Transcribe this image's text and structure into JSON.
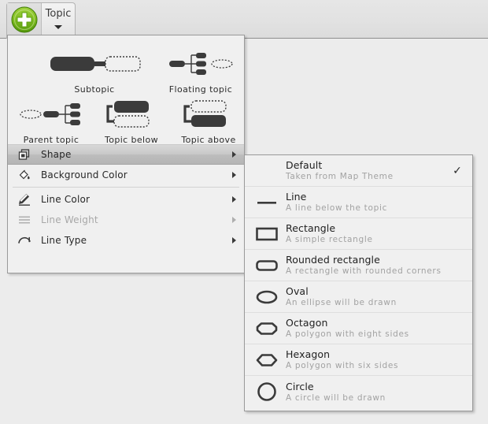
{
  "toolbar": {
    "add_icon": "plus-circle-icon",
    "topic_label": "Topic",
    "dropdown_caret": "caret-down-icon"
  },
  "dropdown": {
    "gallery": [
      {
        "id": "subtopic",
        "label": "Subtopic",
        "icon": "subtopic-icon"
      },
      {
        "id": "floating-topic",
        "label": "Floating topic",
        "icon": "floating-topic-icon"
      },
      {
        "id": "parent-topic",
        "label": "Parent topic",
        "icon": "parent-topic-icon"
      },
      {
        "id": "topic-below",
        "label": "Topic below",
        "icon": "topic-below-icon"
      },
      {
        "id": "topic-above",
        "label": "Topic above",
        "icon": "topic-above-icon"
      }
    ],
    "menu": [
      {
        "id": "shape",
        "label": "Shape",
        "icon": "shape-icon",
        "selected": true,
        "disabled": false,
        "submenu": true
      },
      {
        "id": "background-color",
        "label": "Background Color",
        "icon": "paint-bucket-icon",
        "selected": false,
        "disabled": false,
        "submenu": true
      },
      {
        "id": "line-color",
        "label": "Line Color",
        "icon": "pen-icon",
        "selected": false,
        "disabled": false,
        "submenu": true
      },
      {
        "id": "line-weight",
        "label": "Line Weight",
        "icon": "line-weight-icon",
        "selected": false,
        "disabled": true,
        "submenu": true
      },
      {
        "id": "line-type",
        "label": "Line Type",
        "icon": "line-type-icon",
        "selected": false,
        "disabled": false,
        "submenu": true
      }
    ]
  },
  "submenu": {
    "title": "Shape",
    "checkmark_glyph": "✓",
    "items": [
      {
        "id": "default",
        "title": "Default",
        "desc": "Taken from Map Theme",
        "shape": "none",
        "checked": true
      },
      {
        "id": "line",
        "title": "Line",
        "desc": "A line below the topic",
        "shape": "line",
        "checked": false
      },
      {
        "id": "rectangle",
        "title": "Rectangle",
        "desc": "A simple rectangle",
        "shape": "rectangle",
        "checked": false
      },
      {
        "id": "rounded-rectangle",
        "title": "Rounded rectangle",
        "desc": "A rectangle with rounded corners",
        "shape": "rounded-rectangle",
        "checked": false
      },
      {
        "id": "oval",
        "title": "Oval",
        "desc": "An ellipse will be drawn",
        "shape": "oval",
        "checked": false
      },
      {
        "id": "octagon",
        "title": "Octagon",
        "desc": "A polygon with eight sides",
        "shape": "octagon",
        "checked": false
      },
      {
        "id": "hexagon",
        "title": "Hexagon",
        "desc": "A polygon with six sides",
        "shape": "hexagon",
        "checked": false
      },
      {
        "id": "circle",
        "title": "Circle",
        "desc": "A circle will be drawn",
        "shape": "circle",
        "checked": false
      }
    ]
  },
  "colors": {
    "accent_green": "#6ab023",
    "panel_bg": "#f0f0f0",
    "canvas_bg": "#ececec",
    "shape_dark": "#3b3b3b",
    "desc_gray": "#a2a2a2"
  }
}
